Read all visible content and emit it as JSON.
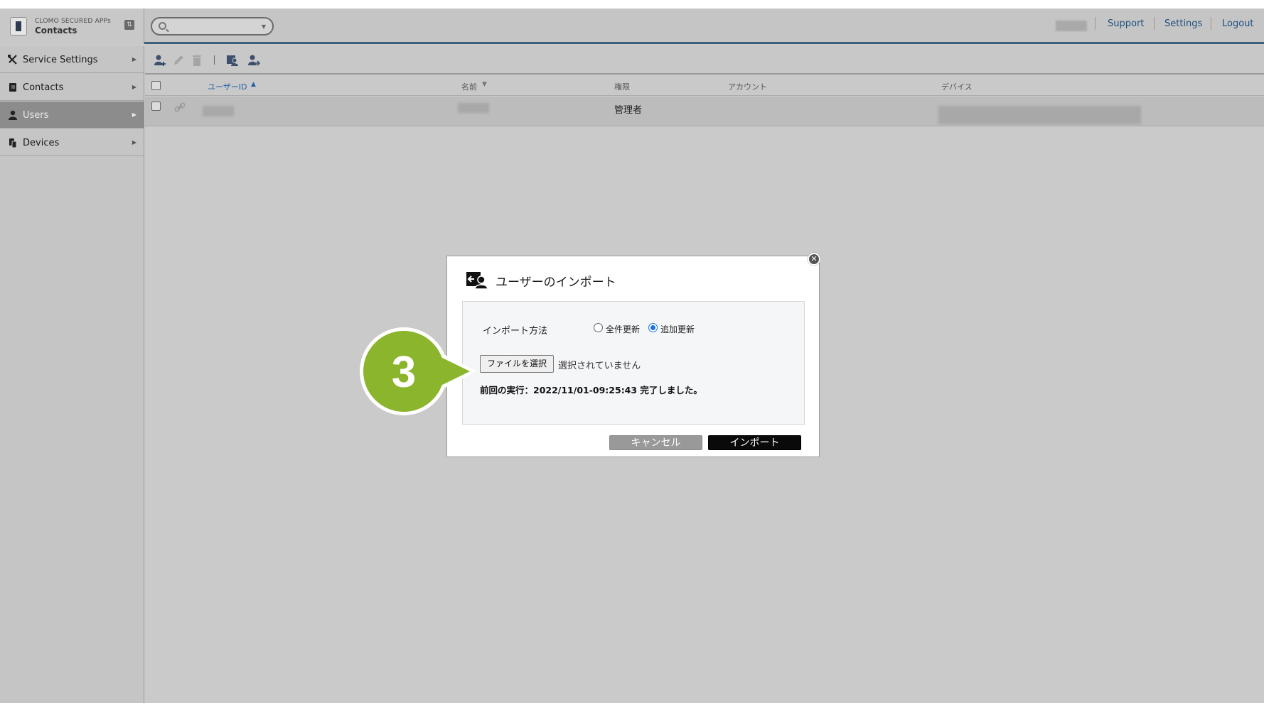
{
  "app": {
    "suite_name": "CLOMO SECURED APPs",
    "name": "Contacts"
  },
  "header": {
    "search_placeholder": "",
    "links": [
      "Support",
      "Settings",
      "Logout"
    ]
  },
  "sidebar": {
    "items": [
      {
        "label": "Service Settings",
        "icon": "tools-icon",
        "active": false
      },
      {
        "label": "Contacts",
        "icon": "contacts-book-icon",
        "active": false
      },
      {
        "label": "Users",
        "icon": "user-icon",
        "active": true
      },
      {
        "label": "Devices",
        "icon": "devices-icon",
        "active": false
      }
    ]
  },
  "toolbar": {
    "icons": [
      "add-user-icon",
      "edit-pencil-icon",
      "delete-trash-icon",
      "import-icon",
      "export-user-icon"
    ]
  },
  "table": {
    "columns": [
      "ユーザーID",
      "名前",
      "権限",
      "アカウント",
      "デバイス"
    ],
    "sort_column": "ユーザーID",
    "rows": [
      {
        "user_id": "",
        "name": "",
        "role": "管理者",
        "account": "",
        "device": ""
      }
    ]
  },
  "modal": {
    "title": "ユーザーのインポート",
    "method_label": "インポート方法",
    "options": [
      "全件更新",
      "追加更新"
    ],
    "selected_option": "追加更新",
    "file_button": "ファイルを選択",
    "file_status": "選択されていません",
    "last_run": "前回の実行：2022/11/01-09:25:43 完了しました。",
    "cancel_label": "キャンセル",
    "import_label": "インポート"
  },
  "callout": {
    "step_number": "3",
    "color": "#8ab52d"
  },
  "colors": {
    "header_accent": "#3f5f7a",
    "link": "#1f4f80",
    "radio_selected": "#1a73e8"
  }
}
